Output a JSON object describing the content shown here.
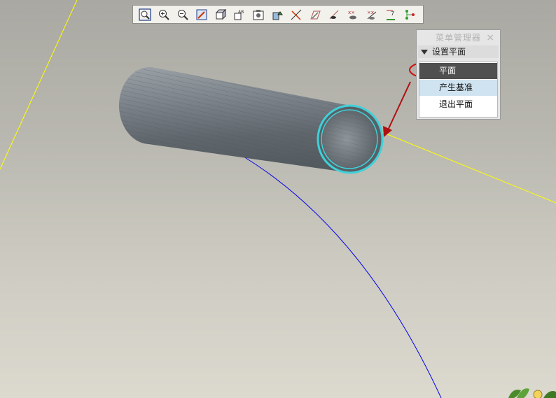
{
  "toolbar": {
    "buttons": [
      {
        "name": "zoom-fit-icon"
      },
      {
        "name": "zoom-in-icon"
      },
      {
        "name": "zoom-out-icon"
      },
      {
        "name": "repaint-icon"
      },
      {
        "name": "view-orientation-icon"
      },
      {
        "name": "saved-views-icon"
      },
      {
        "name": "layers-icon"
      },
      {
        "name": "model-setup-icon"
      },
      {
        "name": "datum-planes-icon"
      },
      {
        "name": "datum-axes-icon"
      },
      {
        "name": "datum-points-icon"
      },
      {
        "name": "coordinate-systems-icon"
      },
      {
        "name": "spin-center-icon"
      },
      {
        "name": "annotations-icon"
      },
      {
        "name": "network-icon"
      }
    ]
  },
  "menu_manager": {
    "title": "菜单管理器",
    "close": "×",
    "header": "设置平面",
    "items": [
      "平面",
      "产生基准",
      "退出平面"
    ],
    "selected_index": 0,
    "hover_index": 1
  },
  "colors": {
    "selected_item": "#505050",
    "hover_item": "#cfe3f0",
    "annotation": "#cc1111",
    "edge_highlight": "#40d0d8",
    "datum_line_yellow": "#ffff00",
    "curve_blue": "#0000ee"
  }
}
